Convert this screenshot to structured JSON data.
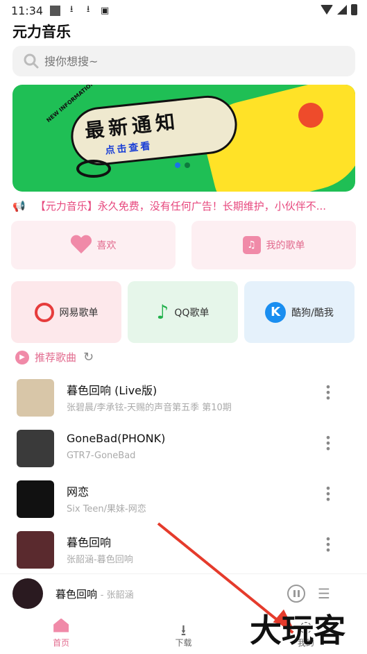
{
  "status_bar": {
    "time": "11:34"
  },
  "app": {
    "title": "元力音乐"
  },
  "search": {
    "placeholder": "搜你想搜~"
  },
  "banner": {
    "title": "最新通知",
    "subtitle": "点击查看",
    "tag": "NEW INFORMATION",
    "page_count": 2,
    "active_page": 1
  },
  "notice": {
    "text": "【元力音乐】永久免费，没有任何广告！长期维护，小伙伴不..."
  },
  "quick_cards": [
    {
      "label": "喜欢",
      "icon": "heart-icon"
    },
    {
      "label": "我的歌单",
      "icon": "playlist-icon"
    }
  ],
  "platform_cards": [
    {
      "label": "网易歌单",
      "icon": "netease-icon"
    },
    {
      "label": "QQ歌单",
      "icon": "qq-music-icon"
    },
    {
      "label": "酷狗/酷我",
      "icon": "kugou-icon"
    }
  ],
  "recommend": {
    "title": "推荐歌曲"
  },
  "songs": [
    {
      "title": "暮色回响 (Live版)",
      "subtitle": "张碧晨/李承铉-天赐的声音第五季 第10期"
    },
    {
      "title": "GoneBad(PHONK)",
      "subtitle": "GTR7-GoneBad"
    },
    {
      "title": "网恋",
      "subtitle": "Six Teen/果妹-网恋"
    },
    {
      "title": "暮色回响",
      "subtitle": "张韶涵-暮色回响"
    }
  ],
  "player": {
    "title": "暮色回响",
    "artist": "- 张韶涵"
  },
  "nav": [
    {
      "label": "首页",
      "active": true
    },
    {
      "label": "下载",
      "active": false
    },
    {
      "label": "我的",
      "active": false
    }
  ],
  "watermark": {
    "text": "大玩客"
  },
  "colors": {
    "accent": "#e26a8e",
    "banner_bg": "#1fbf55",
    "arrow": "#e53b2c"
  }
}
